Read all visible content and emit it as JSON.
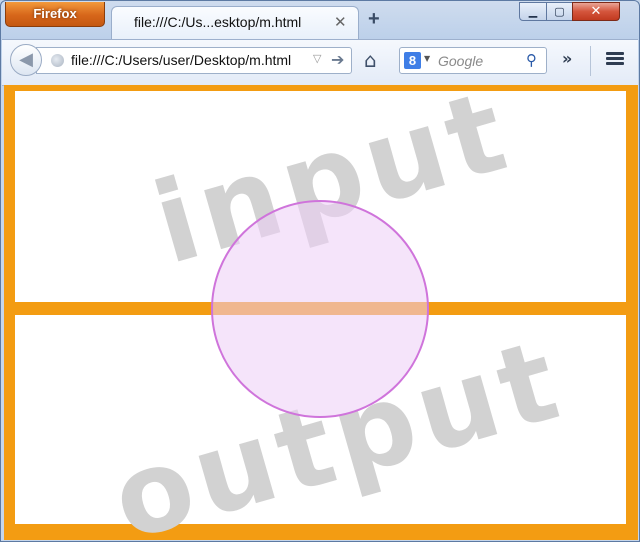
{
  "browser": {
    "app_button": "Firefox",
    "tab": {
      "title": "file:///C:/Us...esktop/m.html",
      "close": "✕"
    },
    "new_tab": "+",
    "window_controls": {
      "minimize": "▁",
      "maximize": "▢",
      "close": "✕"
    }
  },
  "toolbar": {
    "back": "◀",
    "url": "file:///C:/Users/user/Desktop/m.html",
    "url_dropdown": "▽",
    "go": "➔",
    "home": "⌂",
    "search_engine_letter": "8",
    "search_dropdown": "▼",
    "search_placeholder": "Google",
    "search_icon": "⚲",
    "overflow": "»"
  },
  "page": {
    "watermark_top": "input",
    "watermark_bottom": "output",
    "colors": {
      "border": "#f39c12",
      "circle_fill": "#ecccf6",
      "circle_stroke": "#cf74db",
      "watermark": "#d2d2d2"
    }
  }
}
